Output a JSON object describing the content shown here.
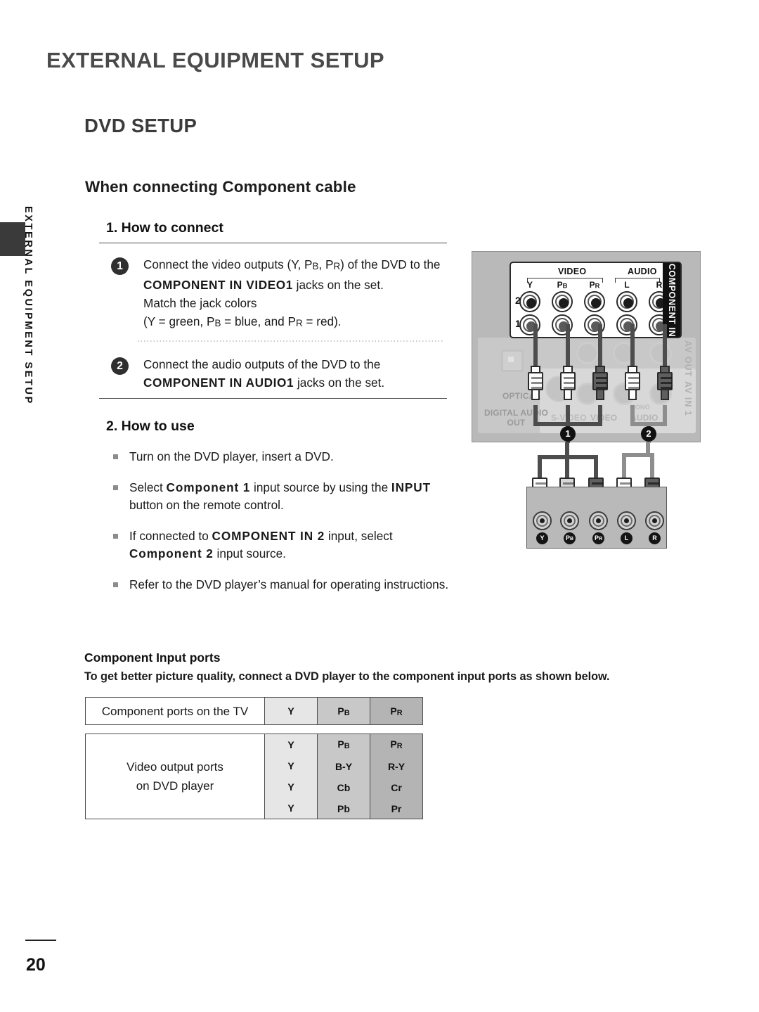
{
  "page": {
    "title": "EXTERNAL EQUIPMENT SETUP",
    "section_title": "DVD SETUP",
    "subsection_title": "When connecting Component cable",
    "side_tab_label": "EXTERNAL EQUIPMENT SETUP",
    "page_number": "20"
  },
  "how_to_connect": {
    "heading": "1. How to connect",
    "steps": [
      {
        "number": "1",
        "line1_pre": "Connect the video outputs (Y, P",
        "line1_sub1": "B",
        "line1_mid": ", P",
        "line1_sub2": "R",
        "line1_post": ")  of the DVD  to the ",
        "bold": "COMPONENT IN VIDEO1",
        "line2_post": " jacks on the set.",
        "line3": "Match the jack colors",
        "line4_pre": "(Y = green, P",
        "line4_sub1": "B",
        "line4_mid": " = blue, and P",
        "line4_sub2": "R",
        "line4_post": " = red)."
      },
      {
        "number": "2",
        "line1": "Connect the audio outputs of the DVD to the",
        "bold": "COMPONENT IN AUDIO1",
        "line2_post": " jacks on the set."
      }
    ]
  },
  "how_to_use": {
    "heading": "2. How to use",
    "bullets": [
      {
        "text": "Turn on the DVD player, insert a DVD."
      },
      {
        "pre": "Select ",
        "bold1": "Component 1",
        "mid": " input source by using the ",
        "bold2": "INPUT",
        "post": " button on the remote control."
      },
      {
        "pre": "If connected to ",
        "bold1": "COMPONENT IN 2",
        "mid": " input, select ",
        "bold2": "Component 2",
        "post": " input source."
      },
      {
        "text": "Refer to the DVD player’s manual for operating instructions."
      }
    ]
  },
  "component_ports": {
    "heading": "Component Input ports",
    "description": "To get better picture quality, connect a DVD player to the component input ports as shown below.",
    "tv_table": {
      "label": "Component ports on the TV",
      "columns": [
        "Y",
        "PB",
        "PR"
      ],
      "col_y": "Y",
      "col_pb_main": "P",
      "col_pb_sub": "B",
      "col_pr_main": "P",
      "col_pr_sub": "R"
    },
    "dvd_table": {
      "label_line1": "Video output ports",
      "label_line2": "on DVD player",
      "rows": [
        {
          "y": "Y",
          "pb": "PB",
          "pr": "PR"
        },
        {
          "y": "Y",
          "pb": "B-Y",
          "pr": "R-Y"
        },
        {
          "y": "Y",
          "pb": "Cb",
          "pr": "Cr"
        },
        {
          "y": "Y",
          "pb": "Pb",
          "pr": "Pr"
        }
      ]
    }
  },
  "diagram": {
    "component_in_label": "COMPONENT IN",
    "video_group": "VIDEO",
    "audio_group": "AUDIO",
    "jack_labels": {
      "y": "Y",
      "pb_main": "P",
      "pb_sub": "B",
      "pr_main": "P",
      "pr_sub": "R",
      "l": "L",
      "r": "R"
    },
    "row_numbers": {
      "row2": "2",
      "row1": "1"
    },
    "faded_labels": {
      "optical": "OPTICAL",
      "digital_audio": "DIGITAL AUDIO",
      "out": "OUT",
      "svideo": "S-VIDEO",
      "video": "VIDEO",
      "audio": "AUDIO",
      "mono": "MONO",
      "av_out": "AV OUT",
      "av_in_1": "AV IN 1"
    },
    "markers": {
      "one": "1",
      "two": "2"
    },
    "dvd_jack_labels": {
      "y": "Y",
      "pb": "P",
      "pb_sub": "B",
      "pr": "P",
      "pr_sub": "R",
      "l": "L",
      "r": "R"
    }
  },
  "colors": {
    "title_gray": "#4a4a4a",
    "col_y": "#e6e6e6",
    "col_pb": "#c8c8c8",
    "col_pr": "#b4b4b4",
    "panel_gray": "#b9b9b9"
  }
}
